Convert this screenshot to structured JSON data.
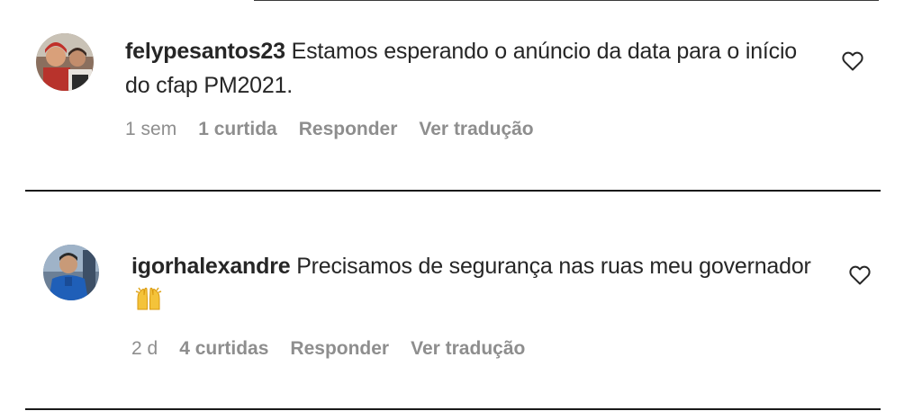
{
  "comments": [
    {
      "username": "felypesantos23",
      "text": "Estamos esperando o anúncio da data para o início do cfap PM2021.",
      "emoji": "",
      "time": "1 sem",
      "likes": "1 curtida",
      "reply_label": "Responder",
      "translate_label": "Ver tradução",
      "heart_icon": "heart-outline-icon"
    },
    {
      "username": "igorhalexandre",
      "text": "Precisamos de segurança nas ruas meu governador",
      "emoji": "raised-hands",
      "time": "2 d",
      "likes": "4 curtidas",
      "reply_label": "Responder",
      "translate_label": "Ver tradução",
      "heart_icon": "heart-outline-icon"
    }
  ],
  "colors": {
    "text": "#262626",
    "meta": "#8e8e8e",
    "divider": "#1a1a1a"
  }
}
